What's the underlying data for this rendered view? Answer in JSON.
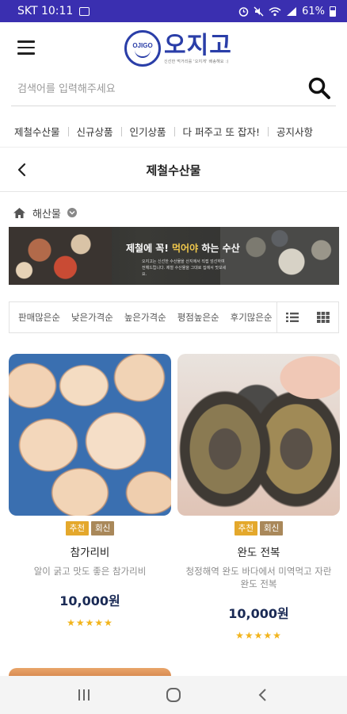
{
  "status_bar": {
    "carrier_time": "SKT 10:11",
    "battery": "61%"
  },
  "header": {
    "logo_badge": "OJIGO",
    "logo_text": "오지고",
    "logo_tagline": "신선한 먹거리를 '오지게' 배송해요 :)"
  },
  "search": {
    "placeholder": "검색어를 입력해주세요"
  },
  "nav": {
    "items": [
      {
        "label": "제철수산물"
      },
      {
        "label": "신규상품"
      },
      {
        "label": "인기상품"
      },
      {
        "label": "다 퍼주고 또 잡자!"
      },
      {
        "label": "공지사항"
      }
    ]
  },
  "subheader": {
    "title": "제철수산물"
  },
  "breadcrumb": {
    "category": "해산물"
  },
  "banner": {
    "title_prefix": "제철에 꼭!",
    "title_highlight": "먹어야",
    "title_suffix": "하는 수산",
    "subtext": "오지고는 신선한 수산물을 산지에서 직접 엄선하여 전해드립니다. 제철 수산물을 그대로 집에서 맛보세요."
  },
  "sort": {
    "items": [
      {
        "label": "판매많은순"
      },
      {
        "label": "낮은가격순"
      },
      {
        "label": "높은가격순"
      },
      {
        "label": "평점높은순"
      },
      {
        "label": "후기많은순"
      }
    ]
  },
  "products": [
    {
      "badge_recommend": "추천",
      "badge_fresh": "회신",
      "name": "참가리비",
      "desc": "알이 굵고 맛도 좋은 참가리비",
      "price": "10,000원",
      "rating": 5,
      "stars": "★★★★★"
    },
    {
      "badge_recommend": "추천",
      "badge_fresh": "회신",
      "name": "완도 전복",
      "desc": "청정해역 완도 바다에서 미역먹고 자란 완도 전복",
      "price": "10,000원",
      "rating": 5,
      "stars": "★★★★★"
    }
  ]
}
